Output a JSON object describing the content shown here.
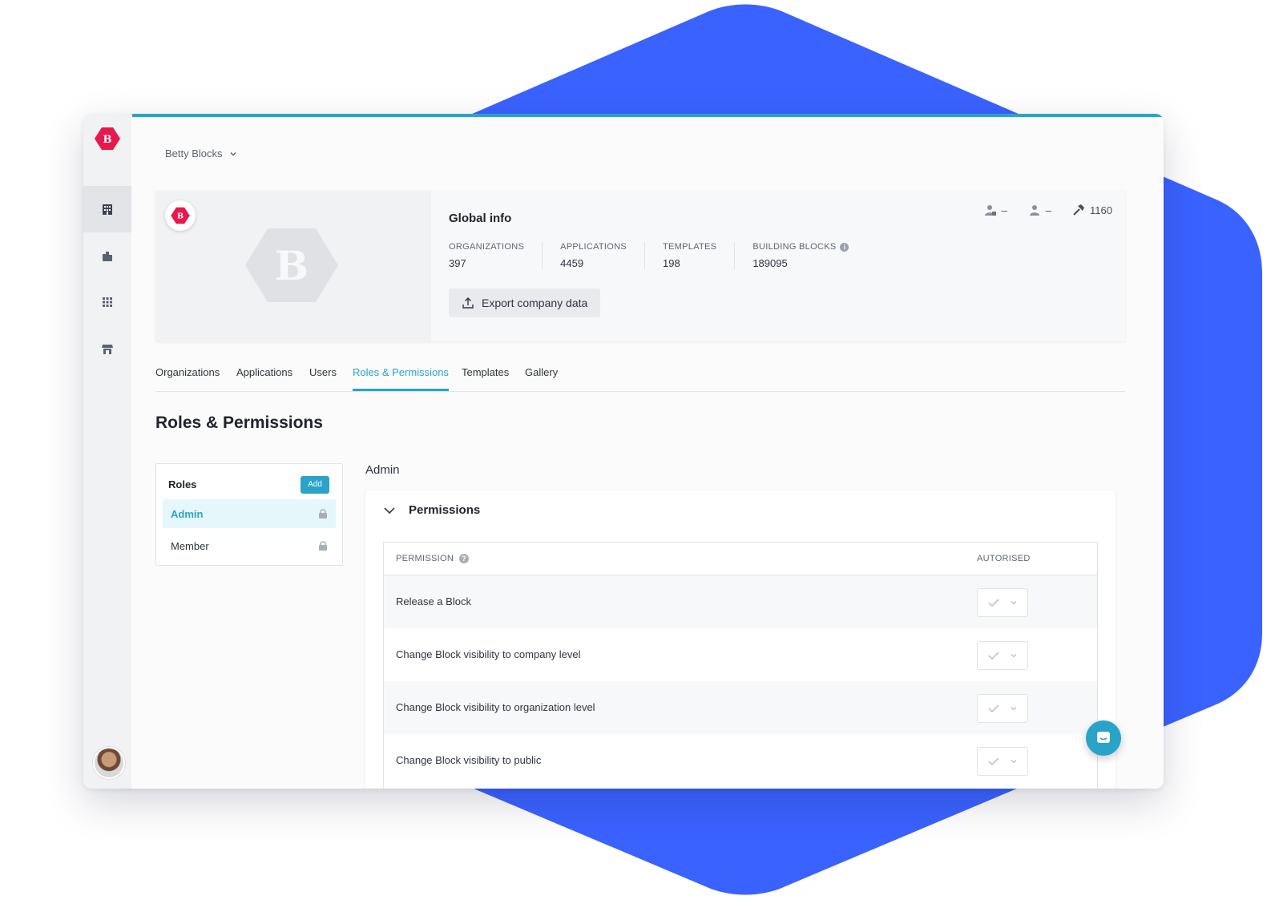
{
  "brand": {
    "accent": "#2aa3c9",
    "logo_red": "#e8174d",
    "hex_blue": "#3a62ff",
    "logo_letter": "B"
  },
  "rail": {
    "items": [
      {
        "icon": "building-icon",
        "active": true
      },
      {
        "icon": "organization-icon",
        "active": false
      },
      {
        "icon": "apps-grid-icon",
        "active": false
      },
      {
        "icon": "store-icon",
        "active": false
      }
    ]
  },
  "header": {
    "company_name": "Betty Blocks"
  },
  "global_info": {
    "title": "Global info",
    "stats": [
      {
        "label": "ORGANIZATIONS",
        "value": "397"
      },
      {
        "label": "APPLICATIONS",
        "value": "4459"
      },
      {
        "label": "TEMPLATES",
        "value": "198"
      },
      {
        "label": "BUILDING BLOCKS",
        "value": "189095"
      }
    ],
    "counters": {
      "builder_users": "–",
      "users": "–",
      "blocks": "1160"
    },
    "export_label": "Export company data"
  },
  "tabs": [
    "Organizations",
    "Applications",
    "Users",
    "Roles & Permissions",
    "Templates",
    "Gallery"
  ],
  "active_tab": "Roles & Permissions",
  "page_title": "Roles & Permissions",
  "roles": {
    "title": "Roles",
    "add_label": "Add",
    "items": [
      {
        "label": "Admin",
        "active": true
      },
      {
        "label": "Member",
        "active": false
      }
    ]
  },
  "selected_role": "Admin",
  "permissions": {
    "title": "Permissions",
    "col_permission": "PERMISSION",
    "col_authorised": "AUTORISED",
    "rows": [
      {
        "label": "Release a Block"
      },
      {
        "label": "Change Block visibility to company level"
      },
      {
        "label": "Change Block visibility to organization level"
      },
      {
        "label": "Change Block visibility to public"
      }
    ]
  }
}
